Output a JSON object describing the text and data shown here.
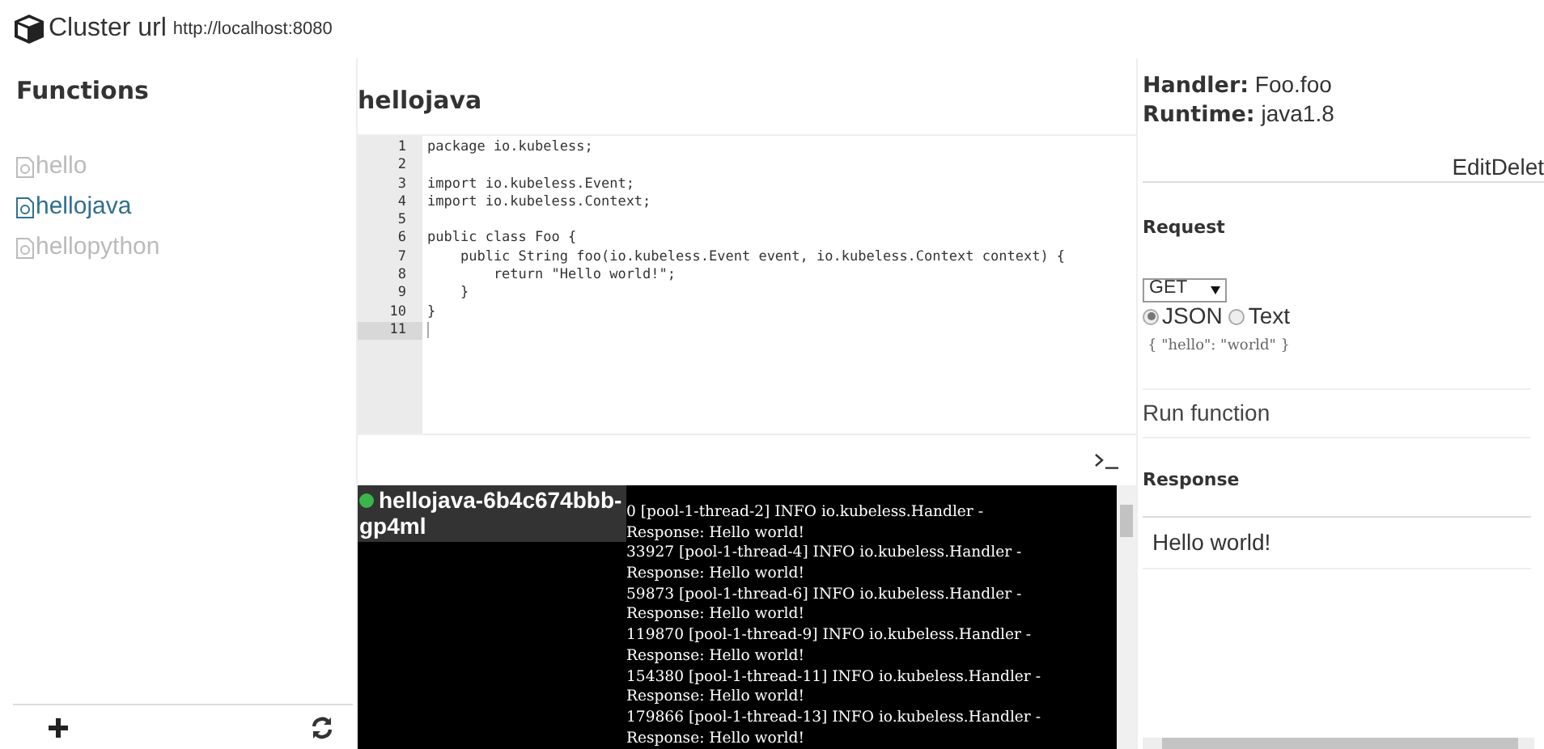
{
  "header": {
    "title": "Cluster url",
    "url": "http://localhost:8080"
  },
  "sidebar": {
    "title": "Functions",
    "items": [
      {
        "label": "hello",
        "selected": false
      },
      {
        "label": "hellojava",
        "selected": true
      },
      {
        "label": "hellopython",
        "selected": false
      }
    ]
  },
  "editor": {
    "title": "hellojava",
    "lines": [
      {
        "number": "1",
        "text": "package io.kubeless;",
        "active": false
      },
      {
        "number": "2",
        "active": false
      },
      {
        "number": "3",
        "text": "import io.kubeless.Event;",
        "active": false
      },
      {
        "number": "4",
        "text": "import io.kubeless.Context;",
        "active": false
      },
      {
        "number": "5",
        "active": false
      },
      {
        "number": "6",
        "text": "public class Foo {",
        "active": false
      },
      {
        "number": "7",
        "text": "    public String foo(io.kubeless.Event event, io.kubeless.Context context) {",
        "active": false
      },
      {
        "number": "8",
        "text": "        return \"Hello world!\";",
        "active": false
      },
      {
        "number": "9",
        "text": "    }",
        "active": false
      },
      {
        "number": "10",
        "text": "}",
        "active": false
      },
      {
        "number": "11",
        "active": true
      }
    ]
  },
  "terminal": {
    "pod": {
      "name": "hellojava-6b4c674bbb-gp4ml",
      "color": "#3cb44b"
    },
    "lines": [
      "0 [pool-1-thread-2] INFO io.kubeless.Handler -",
      "Response: Hello world!",
      "33927 [pool-1-thread-4] INFO io.kubeless.Handler -",
      "Response: Hello world!",
      "59873 [pool-1-thread-6] INFO io.kubeless.Handler -",
      "Response: Hello world!",
      "119870 [pool-1-thread-9] INFO io.kubeless.Handler -",
      "Response: Hello world!",
      "154380 [pool-1-thread-11] INFO io.kubeless.Handler -",
      "Response: Hello world!",
      "179866 [pool-1-thread-13] INFO io.kubeless.Handler -",
      "Response: Hello world!"
    ]
  },
  "details": {
    "handler_label": "Handler:",
    "handler": "Foo.foo",
    "runtime_label": "Runtime:",
    "runtime": "java1.8",
    "actions": [
      "Edit",
      "Delet"
    ]
  },
  "request": {
    "title": "Request",
    "method": "GET",
    "formats": [
      {
        "label": "JSON",
        "selected": true
      },
      {
        "label": "Text",
        "selected": false
      }
    ],
    "body": "{ \"hello\": \"world\" }",
    "run": "Run function"
  },
  "response": {
    "title": "Response",
    "body": "Hello world!"
  }
}
